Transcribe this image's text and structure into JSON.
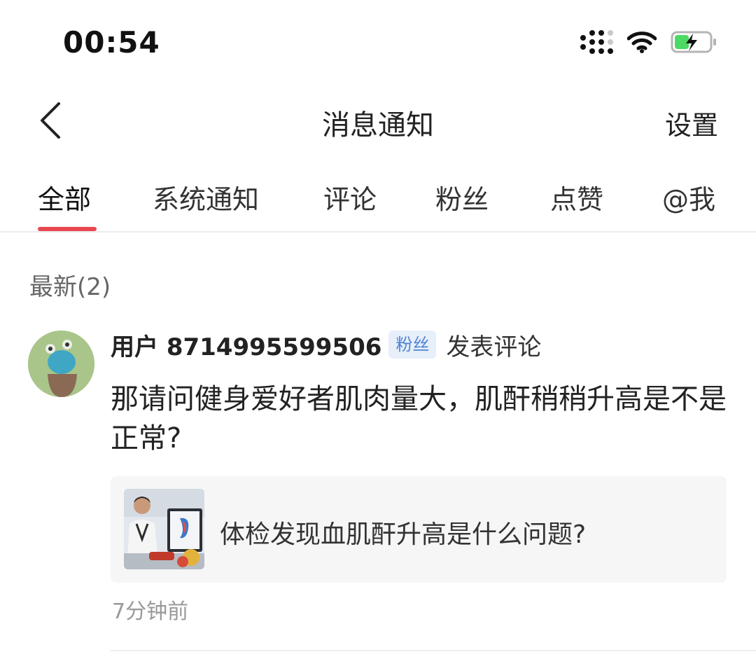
{
  "status_bar": {
    "time": "00:54"
  },
  "nav": {
    "title": "消息通知",
    "settings": "设置"
  },
  "tabs": [
    {
      "label": "全部",
      "active": true
    },
    {
      "label": "系统通知"
    },
    {
      "label": "评论"
    },
    {
      "label": "粉丝"
    },
    {
      "label": "点赞"
    },
    {
      "label": "@我"
    }
  ],
  "section": {
    "title": "最新(2)"
  },
  "notification": {
    "username": "用户 8714995599506",
    "badge": "粉丝",
    "action": "发表评论",
    "comment": "那请问健身爱好者肌肉量大，肌酐稍稍升高是不是正常?",
    "quoted_post_title": "体检发现血肌酐升高是什么问题?",
    "time_ago": "7分钟前"
  },
  "colors": {
    "tab_indicator": "#e8474f",
    "badge_text": "#4d82d6",
    "badge_bg": "#e7effb"
  }
}
